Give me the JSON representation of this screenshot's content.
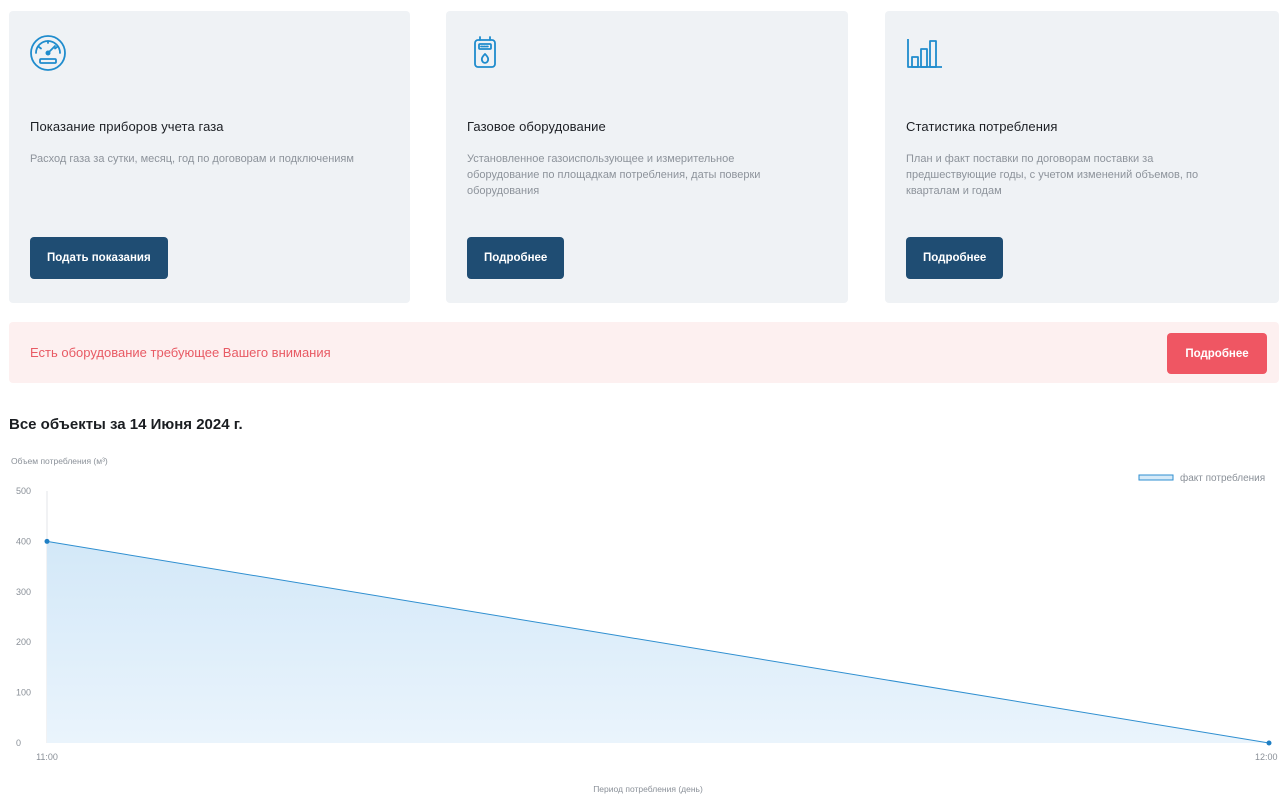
{
  "cards": [
    {
      "icon": "gas-meter-gauge-icon",
      "title": "Показание приборов учета газа",
      "description": "Расход газа за сутки, месяц, год по договорам и подключениям",
      "button_label": "Подать показания"
    },
    {
      "icon": "gas-equipment-icon",
      "title": "Газовое оборудование",
      "description": "Установленное газоиспользующее и измерительное оборудование по площадкам потребления, даты поверки оборудования",
      "button_label": "Подробнее"
    },
    {
      "icon": "bar-chart-icon",
      "title": "Статистика потребления",
      "description": "План и факт поставки по договорам поставки за предшествующие годы, с учетом изменений объемов, по кварталам и годам",
      "button_label": "Подробнее"
    }
  ],
  "alert": {
    "text": "Есть оборудование требующее Вашего внимания",
    "button_label": "Подробнее"
  },
  "section_title": "Все объекты за 14 Июня 2024 г.",
  "colors": {
    "card_bg": "#eff2f5",
    "primary_button": "#1f4d73",
    "alert_bg": "#fdf0f0",
    "alert_text": "#e85a64",
    "alert_button": "#ef5663",
    "series_line": "#2f8fd0",
    "series_fill": "#d6eaf8"
  },
  "chart_data": {
    "type": "area",
    "title": "",
    "ylabel": "Объем потребления (м³)",
    "xlabel": "Период потребления (день)",
    "x": [
      "11:00",
      "12:00"
    ],
    "series": [
      {
        "name": "факт потребления",
        "values": [
          400,
          0
        ]
      }
    ],
    "ylim": [
      0,
      500
    ],
    "yticks": [
      0,
      100,
      200,
      300,
      400,
      500
    ],
    "legend": "top-right",
    "grid": false
  }
}
